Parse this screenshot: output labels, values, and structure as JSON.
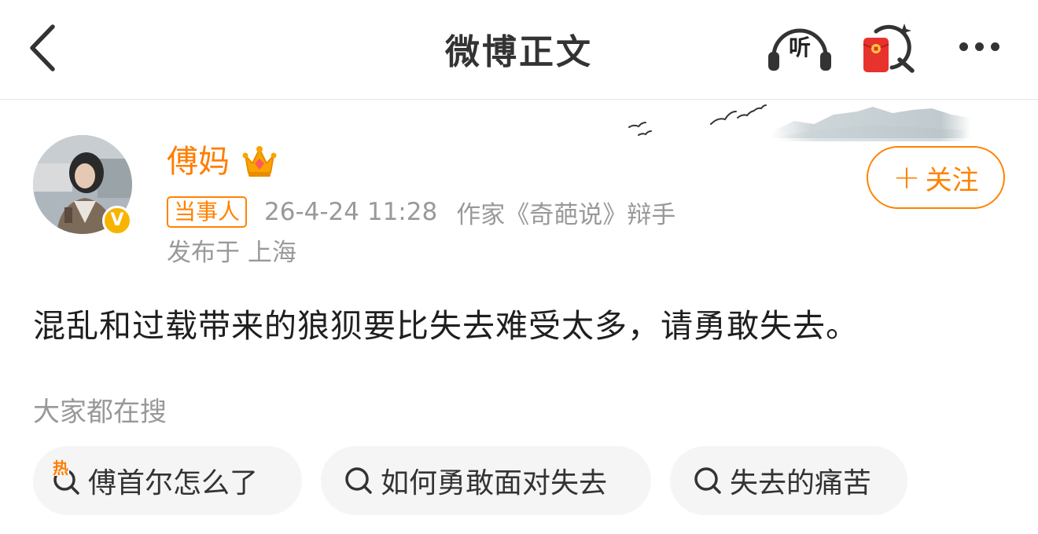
{
  "header": {
    "title": "微博正文",
    "listen_label": "听"
  },
  "author": {
    "name": "傅妈",
    "tag": "当事人",
    "time": "26-4-24 11:28",
    "description": "作家《奇葩说》辩手",
    "location": "发布于 上海",
    "verified_mark": "V",
    "follow_plus": "+",
    "follow_label": "关注"
  },
  "post": {
    "content": "混乱和过载带来的狼狈要比失去难受太多，请勇敢失去。"
  },
  "search": {
    "title": "大家都在搜",
    "hot_mark": "热",
    "chips": [
      {
        "label": "傅首尔怎么了",
        "icon": "hot-search-icon"
      },
      {
        "label": "如何勇敢面对失去",
        "icon": "search-icon"
      },
      {
        "label": "失去的痛苦",
        "icon": "search-icon"
      }
    ]
  },
  "colors": {
    "accent": "#ff8200",
    "name": "#ff7d00",
    "meta": "#999999",
    "verified": "#f7b500",
    "envelope": "#e8322e"
  }
}
